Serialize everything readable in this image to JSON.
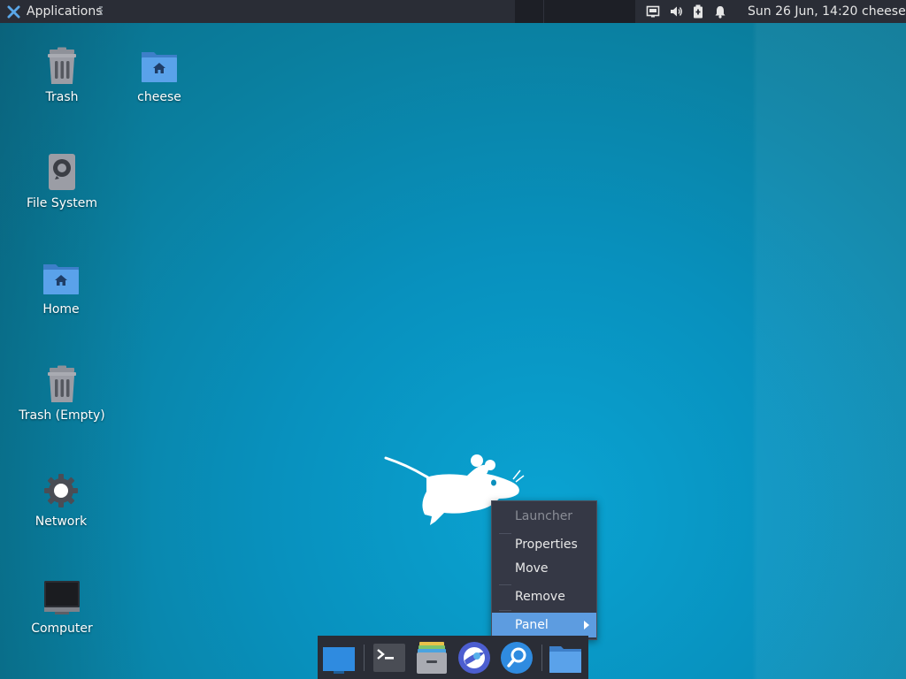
{
  "top_panel": {
    "applications_label": "Applications",
    "clock": "Sun 26 Jun, 14:20",
    "user": "cheese"
  },
  "desktop_icons": [
    {
      "label": "Trash",
      "icon": "trash-icon"
    },
    {
      "label": "cheese",
      "icon": "home-folder-icon"
    },
    {
      "label": "File System",
      "icon": "drive-icon"
    },
    {
      "label": "Home",
      "icon": "home-folder-icon"
    },
    {
      "label": "Trash (Empty)",
      "icon": "trash-icon"
    },
    {
      "label": "Network",
      "icon": "network-icon"
    },
    {
      "label": "Computer",
      "icon": "computer-icon"
    }
  ],
  "context_menu": {
    "header": "Launcher",
    "items": [
      "Properties",
      "Move",
      "Remove",
      "Panel"
    ]
  },
  "dock": {
    "items": [
      "show-desktop-icon",
      "terminal-icon",
      "file-manager-icon",
      "web-browser-icon",
      "app-finder-icon",
      "folder-icon"
    ]
  },
  "colors": {
    "panel": "#2a2d36",
    "desktop": "#0891be",
    "menu_highlight": "#5d9ce0"
  }
}
